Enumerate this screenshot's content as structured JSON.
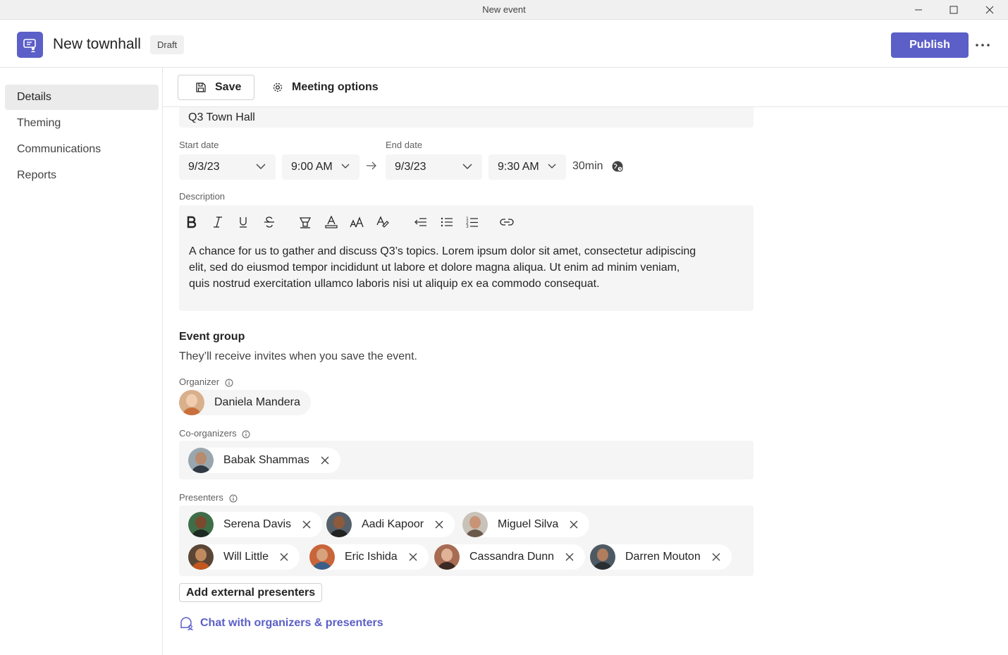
{
  "window": {
    "title": "New event"
  },
  "header": {
    "title": "New townhall",
    "badge": "Draft",
    "publish_label": "Publish"
  },
  "sidebar": {
    "items": [
      {
        "label": "Details",
        "active": true
      },
      {
        "label": "Theming",
        "active": false
      },
      {
        "label": "Communications",
        "active": false
      },
      {
        "label": "Reports",
        "active": false
      }
    ]
  },
  "toolbar": {
    "save_label": "Save",
    "meeting_options_label": "Meeting options"
  },
  "form": {
    "event_title": "Q3 Town Hall",
    "start_date_label": "Start date",
    "start_date": "9/3/23",
    "start_time": "9:00 AM",
    "end_date_label": "End date",
    "end_date": "9/3/23",
    "end_time": "9:30 AM",
    "duration": "30min",
    "description_label": "Description",
    "description_text": "A chance for us to gather and discuss Q3’s topics. Lorem ipsum dolor sit amet, consectetur adipiscing elit, sed do eiusmod tempor incididunt ut labore et dolore magna aliqua. Ut enim ad minim veniam, quis nostrud exercitation ullamco laboris nisi ut aliquip ex ea commodo consequat."
  },
  "event_group": {
    "heading": "Event group",
    "subtext": "They’ll receive invites when you save the event.",
    "organizer_label": "Organizer",
    "organizer": {
      "name": "Daniela Mandera"
    },
    "coorganizers_label": "Co-organizers",
    "coorganizers": [
      {
        "name": "Babak Shammas"
      }
    ],
    "presenters_label": "Presenters",
    "presenters": [
      {
        "name": "Serena Davis"
      },
      {
        "name": "Aadi Kapoor"
      },
      {
        "name": "Miguel Silva"
      },
      {
        "name": "Will Little"
      },
      {
        "name": "Eric Ishida"
      },
      {
        "name": "Cassandra Dunn"
      },
      {
        "name": "Darren Mouton"
      }
    ],
    "add_external_label": "Add external presenters",
    "chat_link_label": "Chat with organizers & presenters"
  },
  "colors": {
    "accent": "#5b5fc7",
    "field_bg": "#f5f5f5"
  }
}
